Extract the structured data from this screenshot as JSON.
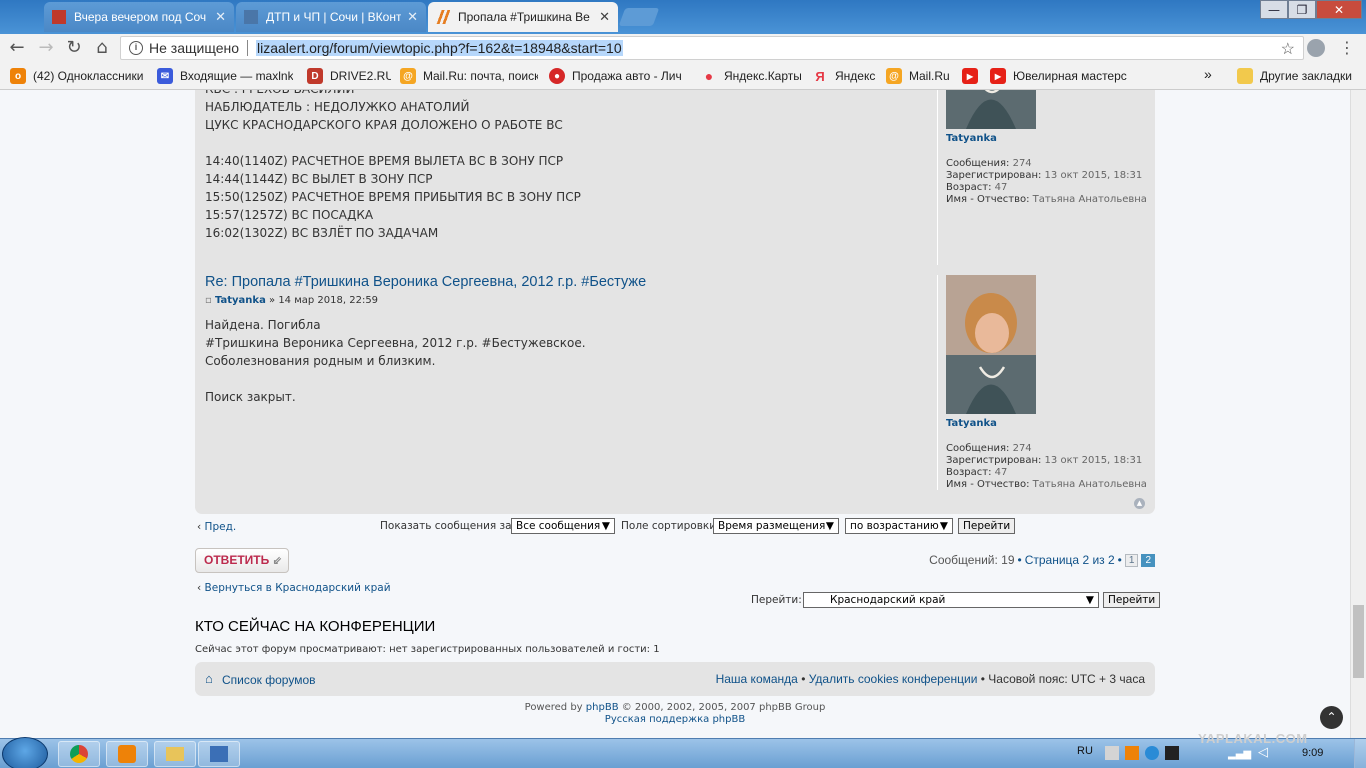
{
  "browser": {
    "tabs": [
      {
        "title": "Вчера вечером под Соч",
        "icon_color": "#c0392b"
      },
      {
        "title": "ДТП и ЧП | Сочи | ВКонт",
        "icon_color": "#4a76a8"
      },
      {
        "title": "Пропала #Тришкина Ве",
        "icon_color": "#e67e22"
      }
    ],
    "security_label": "Не защищено",
    "url": "lizaalert.org/forum/viewtopic.php?f=162&t=18948&start=10",
    "bookmarks": [
      {
        "label": "(42) Одноклассники",
        "icon_color": "#ee8208",
        "icon_char": "o"
      },
      {
        "label": "Входящие — maxlnk",
        "icon_color": "#3b5bdb",
        "icon_char": "✉"
      },
      {
        "label": "DRIVE2.RU",
        "icon_color": "#c0392b",
        "icon_char": "D"
      },
      {
        "label": "Mail.Ru: почта, поиск",
        "icon_color": "#f5a623",
        "icon_char": "@"
      },
      {
        "label": "Продажа авто - Лич",
        "icon_color": "#d62828",
        "icon_char": "●"
      },
      {
        "label": "Яндекс.Карты",
        "icon_color": "#e63946",
        "icon_char": "♦"
      },
      {
        "label": "Яндекс",
        "icon_color": "#e63946",
        "icon_char": "Я"
      },
      {
        "label": "Mail.Ru",
        "icon_color": "#f5a623",
        "icon_char": "@"
      },
      {
        "label": "",
        "icon_color": "#e62117",
        "icon_char": "▶"
      },
      {
        "label": "Ювелирная мастерс",
        "icon_color": "#e62117",
        "icon_char": "▶"
      }
    ],
    "more_bookmarks": "»",
    "other_bookmarks": "Другие закладки"
  },
  "post1": {
    "lines": [
      "КВС : ГРЕХОВ ВАСИЛИЙ",
      "НАБЛЮДАТЕЛЬ : НЕДОЛУЖКО АНАТОЛИЙ",
      "ЦУКС КРАСНОДАРСКОГО КРАЯ ДОЛОЖЕНО О РАБОТЕ ВС",
      "",
      "14:40(1140Z) РАСЧЕТНОЕ ВРЕМЯ ВЫЛЕТА ВС В ЗОНУ ПСР",
      "14:44(1144Z) ВС ВЫЛЕТ В ЗОНУ ПСР",
      "15:50(1250Z) РАСЧЕТНОЕ ВРЕМЯ ПРИБЫТИЯ ВС В ЗОНУ ПСР",
      "15:57(1257Z) ВС ПОСАДКА",
      "16:02(1302Z) ВС ВЗЛЁТ ПО ЗАДАЧАМ"
    ],
    "profile": {
      "username": "Tatyanka",
      "posts_label": "Сообщения:",
      "posts": "274",
      "registered_label": "Зарегистрирован:",
      "registered": "13 окт 2015, 18:31",
      "age_label": "Возраст:",
      "age": "47",
      "name_label": "Имя - Отчество:",
      "name": "Татьяна Анатольевна"
    }
  },
  "post2": {
    "title": "Re: Пропала #Тришкина Вероника Сергеевна, 2012 г.р. #Бестуже",
    "author": "Tatyanka",
    "date": "» 14 мар 2018, 22:59",
    "lines": [
      "Найдена. Погибла",
      "#Тришкина Вероника Сергеевна, 2012 г.р. #Бестужевское.",
      "Соболезнования родным и близким.",
      "",
      "Поиск закрыт."
    ],
    "profile": {
      "username": "Tatyanka",
      "posts_label": "Сообщения:",
      "posts": "274",
      "registered_label": "Зарегистрирован:",
      "registered": "13 окт 2015, 18:31",
      "age_label": "Возраст:",
      "age": "47",
      "name_label": "Имя - Отчество:",
      "name": "Татьяна Анатольевна"
    }
  },
  "sortbar": {
    "prev": "Пред.",
    "show_label": "Показать сообщения за:",
    "show_value": "Все сообщения",
    "sort_label": "Поле сортировки",
    "sort_value": "Время размещения",
    "order_value": "по возрастанию",
    "go": "Перейти"
  },
  "reply_label": "ОТВЕТИТЬ",
  "pagination": {
    "count_text": "Сообщений: 19",
    "bullet": "•",
    "page_text": "Страница 2 из 2",
    "pages": [
      "1",
      "2"
    ]
  },
  "back_link": "Вернуться в Краснодарский край",
  "jump": {
    "label": "Перейти:",
    "value": "Краснодарский край",
    "go": "Перейти"
  },
  "online": {
    "heading": "КТО СЕЙЧАС НА КОНФЕРЕНЦИИ",
    "text": "Сейчас этот форум просматривают: нет зарегистрированных пользователей и гости: 1"
  },
  "footer_nav": {
    "index": "Список форумов",
    "team": "Наша команда",
    "delete_cookies": "Удалить cookies конференции",
    "timezone": "Часовой пояс: UTC + 3 часа"
  },
  "copyright": {
    "powered": "Powered by",
    "phpbb": "phpBB",
    "rest": "© 2000, 2002, 2005, 2007 phpBB Group",
    "support": "Русская поддержка phpBB"
  },
  "taskbar": {
    "lang": "RU",
    "time": "9:09",
    "watermark": "YAPLAKAL.COM"
  }
}
